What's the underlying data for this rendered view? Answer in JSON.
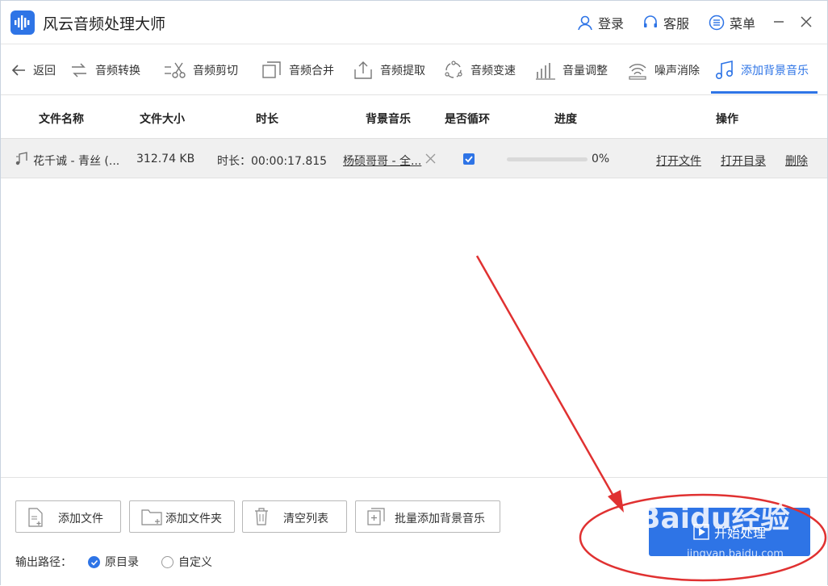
{
  "app": {
    "title": "风云音频处理大师",
    "accent": "#2e74e6"
  },
  "titlebar": {
    "login": "登录",
    "support": "客服",
    "menu": "菜单"
  },
  "toolbar": {
    "back": "返回",
    "tools": [
      {
        "label": "音频转换",
        "icon": "convert-icon"
      },
      {
        "label": "音频剪切",
        "icon": "scissors-icon"
      },
      {
        "label": "音频合并",
        "icon": "merge-icon"
      },
      {
        "label": "音频提取",
        "icon": "extract-icon"
      },
      {
        "label": "音频变速",
        "icon": "speed-icon"
      },
      {
        "label": "音量调整",
        "icon": "volume-bars-icon"
      },
      {
        "label": "噪声消除",
        "icon": "noise-icon"
      },
      {
        "label": "添加背景音乐",
        "icon": "music-note-icon",
        "active": true
      }
    ]
  },
  "table": {
    "headers": [
      "文件名称",
      "文件大小",
      "时长",
      "背景音乐",
      "是否循环",
      "进度",
      "操作"
    ],
    "rows": [
      {
        "name": "花千诚 - 青丝 (...",
        "size": "312.74 KB",
        "duration": "时长：00:00:17.815",
        "bgm": "杨硕哥哥 - 全...",
        "loop": true,
        "progress_pct": 0,
        "progress_text": "0%",
        "open_file": "打开文件",
        "open_dir": "打开目录",
        "delete": "删除"
      }
    ]
  },
  "bottom": {
    "add_file": "添加文件",
    "add_folder": "添加文件夹",
    "clear_list": "清空列表",
    "batch_add_bgm": "批量添加背景音乐",
    "output_label": "输出路径：",
    "opt_original": "原目录",
    "opt_custom": "自定义",
    "start": "开始处理"
  },
  "watermark": {
    "main": "Baidu经验",
    "sub": "jingyan.baidu.com"
  }
}
